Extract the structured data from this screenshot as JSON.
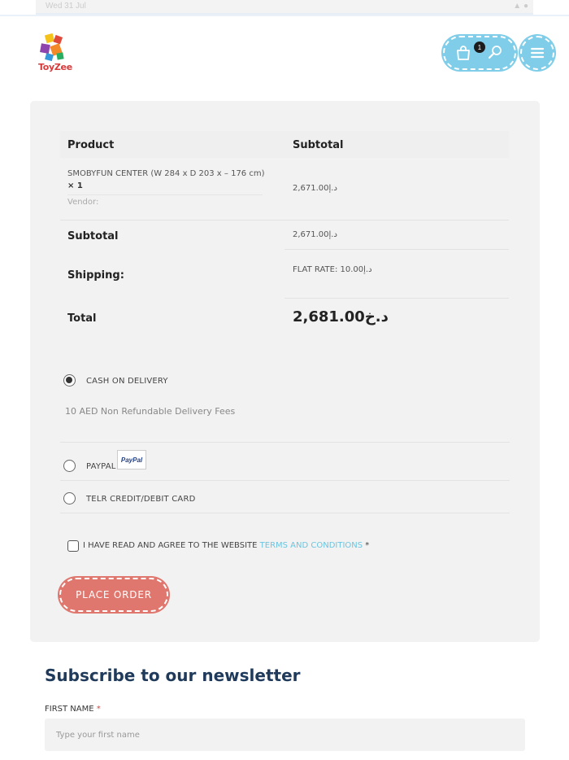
{
  "status_bar": {
    "time": "Wed 31 Jul",
    "right": "▲ ●"
  },
  "header": {
    "logo_text": "ToyZee",
    "cart_count": "1"
  },
  "order": {
    "headers": {
      "product": "Product",
      "subtotal": "Subtotal"
    },
    "item": {
      "name": "SMOBYFUN CENTER (W 284 x D 203 x – 176 cm)",
      "qty": "× 1",
      "vendor": "Vendor:",
      "price": "د.إ2,671.00"
    },
    "subtotal_label": "Subtotal",
    "subtotal_value": "د.إ2,671.00",
    "shipping_label": "Shipping:",
    "shipping_value": "FLAT RATE: د.إ10.00",
    "total_label": "Total",
    "total_value": "د.خ2,681.00"
  },
  "payment": {
    "methods": [
      {
        "label": "CASH ON DELIVERY",
        "selected": true,
        "description": "10 AED Non Refundable Delivery Fees"
      },
      {
        "label": "PAYPAL",
        "selected": false,
        "logo_text": "PayPal"
      },
      {
        "label": "TELR CREDIT/DEBIT CARD",
        "selected": false
      }
    ]
  },
  "terms": {
    "text": "I HAVE READ AND AGREE TO THE WEBSITE ",
    "link": "TERMS AND CONDITIONS",
    "required": " *"
  },
  "place_order_label": "PLACE ORDER",
  "newsletter": {
    "title": "Subscribe to our newsletter",
    "first_name_label": "FIRST NAME",
    "required": "*",
    "first_name_placeholder": "Type your first name"
  }
}
